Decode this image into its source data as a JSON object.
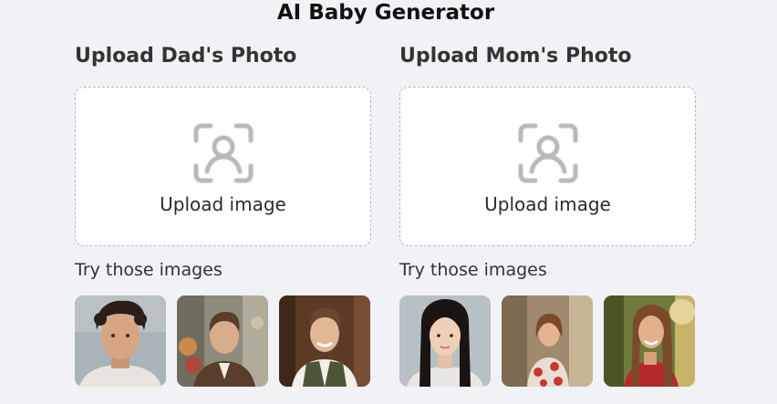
{
  "page": {
    "title": "AI Baby Generator"
  },
  "dad": {
    "heading": "Upload Dad's Photo",
    "upload_label": "Upload image",
    "try_label": "Try those images",
    "samples": [
      "male-portrait-1",
      "male-portrait-2",
      "male-portrait-3"
    ]
  },
  "mom": {
    "heading": "Upload Mom's Photo",
    "upload_label": "Upload image",
    "try_label": "Try those images",
    "samples": [
      "female-portrait-1",
      "female-portrait-2",
      "female-portrait-3"
    ]
  },
  "colors": {
    "background": "#f1f2f6",
    "card": "#ffffff",
    "border": "#b5b8c2",
    "icon": "#b8b8b8"
  },
  "icons": {
    "upload": "face-scan-icon"
  }
}
